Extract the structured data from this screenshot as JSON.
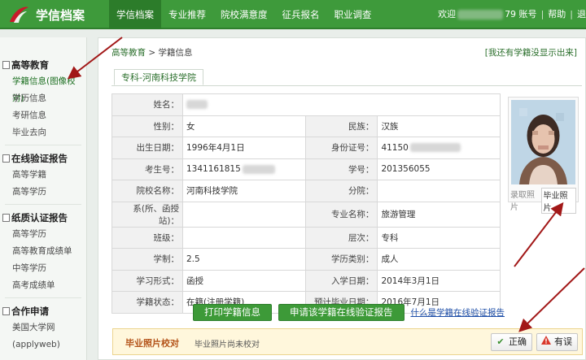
{
  "header": {
    "logo_text": "学信档案",
    "nav": [
      "学信档案",
      "专业推荐",
      "院校满意度",
      "征兵报名",
      "职业调查"
    ],
    "welcome": "欢迎",
    "account_suffix": "79 账号",
    "help": "帮助",
    "logout": "退"
  },
  "sidebar": {
    "sections": [
      {
        "title": "高等教育",
        "items": [
          "学籍信息(图像校对)",
          "学历信息",
          "考研信息",
          "毕业去向"
        ]
      },
      {
        "title": "在线验证报告",
        "items": [
          "高等学籍",
          "高等学历"
        ]
      },
      {
        "title": "纸质认证报告",
        "items": [
          "高等学历",
          "高等教育成绩单",
          "中等学历",
          "高考成绩单"
        ]
      },
      {
        "title": "合作申请",
        "items": [
          "美国大学网",
          "(applyweb)"
        ]
      }
    ]
  },
  "main": {
    "breadcrumb_root": "高等教育",
    "breadcrumb_sep": ">",
    "breadcrumb_current": "学籍信息",
    "not_shown_link": "[我还有学籍没显示出来]",
    "tab": "专科-河南科技学院",
    "rows": [
      {
        "l1": "姓名：",
        "v1": "",
        "l2": "",
        "v2": ""
      },
      {
        "l1": "性别：",
        "v1": "女",
        "l2": "民族：",
        "v2": "汉族"
      },
      {
        "l1": "出生日期：",
        "v1": "1996年4月1日",
        "l2": "身份证号：",
        "v2": "41150"
      },
      {
        "l1": "考生号：",
        "v1": "1341161815",
        "l2": "学号：",
        "v2": "201356055"
      },
      {
        "l1": "院校名称：",
        "v1": "河南科技学院",
        "l2": "分院：",
        "v2": ""
      },
      {
        "l1": "系(所、函授站)：",
        "v1": "",
        "l2": "专业名称：",
        "v2": "旅游管理"
      },
      {
        "l1": "班级：",
        "v1": "",
        "l2": "层次：",
        "v2": "专科"
      },
      {
        "l1": "学制：",
        "v1": "2.5",
        "l2": "学历类别：",
        "v2": "成人"
      },
      {
        "l1": "学习形式：",
        "v1": "函授",
        "l2": "入学日期：",
        "v2": "2014年3月1日"
      },
      {
        "l1": "学籍状态：",
        "v1": "在籍(注册学籍)",
        "l2": "预计毕业日期：",
        "v2": "2016年7月1日"
      }
    ],
    "photo_tabs": [
      "录取照片",
      "毕业照片"
    ],
    "buttons": {
      "print": "打印学籍信息",
      "apply_report": "申请该学籍在线验证报告",
      "what_is": "什么是学籍在线验证报告"
    },
    "verify": {
      "title": "毕业照片校对",
      "status": "毕业照片尚未校对",
      "correct": "正确",
      "wrong": "有误"
    }
  },
  "colors": {
    "header_green": "#3e9a3b",
    "annotation_arrow": "#a21818"
  }
}
